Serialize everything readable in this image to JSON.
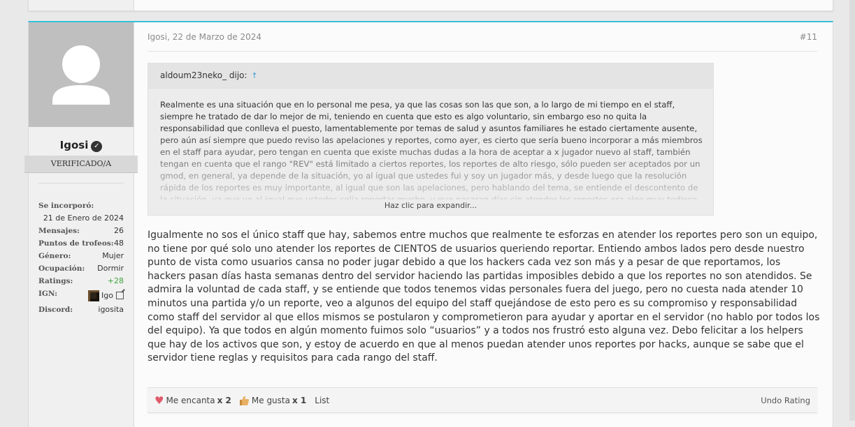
{
  "post": {
    "author": "Igosi",
    "date": "Igosi, 22 de Marzo de 2024",
    "number": "#11",
    "user_title": "VERIFICADO/A",
    "stats": [
      {
        "label": "Se incorporó:",
        "value": "21 de Enero de 2024"
      },
      {
        "label": "Mensajes:",
        "value": "26"
      },
      {
        "label": "Puntos de trofeos:",
        "value": "48"
      },
      {
        "label": "Género:",
        "value": "Mujer"
      },
      {
        "label": "Ocupación:",
        "value": "Dormir"
      },
      {
        "label": "Ratings:",
        "value": "+28"
      },
      {
        "label": "IGN:",
        "value": "Igo"
      },
      {
        "label": "Discord:",
        "value": "igosita"
      }
    ],
    "quote": {
      "author_line": "aldoum23neko_ dijo:",
      "arrow": "↑",
      "text": "Realmente es una situación que en lo personal me pesa, ya que las cosas son las que son, a lo largo de mi tiempo en el staff, siempre he tratado de dar lo mejor de mi, teniendo en cuenta que esto es algo voluntario, sin embargo eso no quita la responsabilidad que conlleva el puesto, lamentablemente por temas de salud y asuntos familiares he estado ciertamente ausente, pero aún así siempre que puedo reviso las apelaciones y reportes, como ayer, es cierto que sería bueno incorporar a más miembros en el staff para ayudar, pero tengan en cuenta que existe muchas dudas a la hora de aceptar a x jugador nuevo al staff, también tengan en cuenta que el rango \"REV\" está limitado a ciertos reportes, los reportes de alto riesgo, sólo pueden ser aceptados por un gmod, en general, ya depende de la situación, yo al igual que ustedes fui y soy un jugador más, y desde luego que la resolución rápida de los reportes es muy importante, al igual que son las apelaciones, pero hablando del tema, se entiende el descontento de la situación, ya que yo al igual que ustedes solía reportar mucho, y que pasaran días sin atender los reportes era algo muy tedioso.",
      "expand": "Haz clic para expandir..."
    },
    "message": "Igualmente no sos el único staff que hay, sabemos entre muchos que realmente te esforzas en atender los reportes pero son un equipo, no tiene por qué solo uno atender los reportes de CIENTOS de usuarios queriendo reportar. Entiendo ambos lados pero desde nuestro punto de vista como usuarios cansa no poder jugar debido a que los hackers cada vez son más y a pesar de que reportamos, los hackers pasan días hasta semanas dentro del servidor haciendo las partidas imposibles debido a que los reportes no son atendidos. Se admira la voluntad de cada staff, y se entiende que todos tenemos vidas personales fuera del juego, pero no cuesta nada atender 10 minutos una partida y/o un reporte, veo a algunos del equipo del staff quejándose de esto pero es su compromiso y responsabilidad como staff del servidor al que ellos mismos se postularon y comprometieron para ayudar y aportar en el servidor (no hablo por todos los del equipo). Ya que todos en algún momento fuimos solo “usuarios” y a todos nos frustró esto alguna vez. Debo felicitar a los helpers que hay de los activos que son, y estoy de acuerdo en que al menos puedan atender unos reportes por hacks, aunque se sabe que el servidor tiene reglas y requisitos para cada rango del staff."
  },
  "ratings": {
    "love_label": "Me encanta",
    "love_count": "x 2",
    "like_label": "Me gusta",
    "like_count": "x 1",
    "list_label": "List",
    "undo_label": "Undo Rating"
  },
  "icons": {
    "verified": "check-circle-icon",
    "love": "heart-icon",
    "like": "thumbs-up-icon",
    "external": "external-link-icon"
  },
  "colors": {
    "accent": "#35c0d8",
    "link": "#3a9bd5",
    "positive": "#3fa33f"
  }
}
